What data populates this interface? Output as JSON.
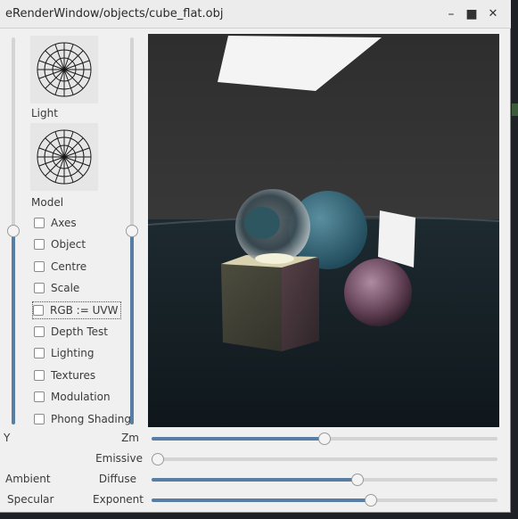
{
  "window": {
    "title": "eRenderWindow/objects/cube_flat.obj",
    "minimize": "–",
    "maximize": "■",
    "close": "✕"
  },
  "panel": {
    "light_label": "Light",
    "model_label": "Model",
    "checkboxes": [
      {
        "label": "Axes",
        "checked": false
      },
      {
        "label": "Object",
        "checked": false
      },
      {
        "label": "Centre",
        "checked": false
      },
      {
        "label": "Scale",
        "checked": false
      },
      {
        "label": "RGB := UVW",
        "checked": false
      },
      {
        "label": "Depth Test",
        "checked": false
      },
      {
        "label": "Lighting",
        "checked": false
      },
      {
        "label": "Textures",
        "checked": false
      },
      {
        "label": "Modulation",
        "checked": false
      },
      {
        "label": "Phong Shading",
        "checked": false
      }
    ]
  },
  "vsliders": {
    "left_level": 0.5,
    "right_level": 0.5
  },
  "sliders": {
    "y_label": "Y",
    "zm_label": "Zm",
    "zm_value": 0.5,
    "emissive_label": "Emissive",
    "emissive_value": 0.0,
    "ambient_label": "Ambient",
    "diffuse_label": "Diffuse",
    "diffuse_value": 0.6,
    "specular_label": "Specular",
    "exponent_label": "Exponent",
    "exponent_value": 0.64
  },
  "colors": {
    "accent": "#587ea4",
    "window_bg": "#f0f0f0"
  }
}
